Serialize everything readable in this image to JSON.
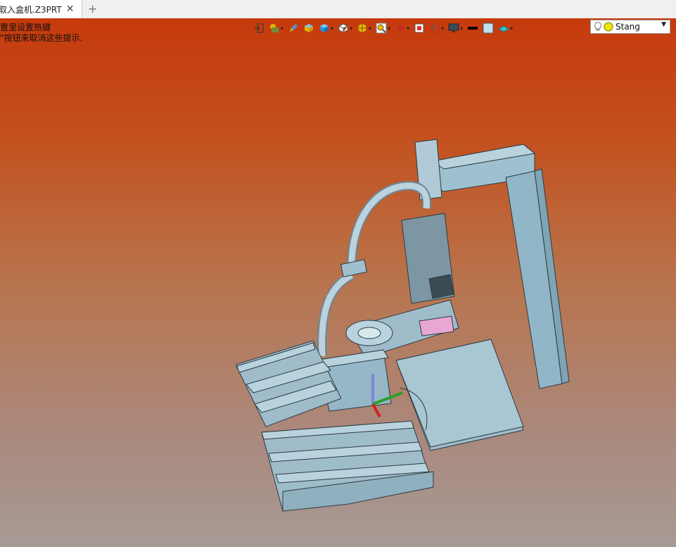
{
  "tab": {
    "title": "取入盒机.Z3PRT",
    "close": "✕",
    "add": "+"
  },
  "hint": {
    "line1": "置里设置热键",
    "line2": "\"按钮来取消这些提示."
  },
  "toolbar": {
    "items": [
      "exit-view",
      "display-mode",
      "sketch-pen",
      "shaded-box",
      "blue-box",
      "wireframe-box",
      "section-view",
      "zoom-view",
      "axis-cross",
      "focus-view",
      "fit-frame",
      "monitor-view",
      "black-bar",
      "background-color",
      "layer-tool"
    ],
    "style": {
      "label": "Stang"
    }
  },
  "colors": {
    "viewport_top": "#c63a0c",
    "viewport_bottom": "#a79a95",
    "model": "#9fc0cf",
    "edge": "#2c3a40"
  }
}
